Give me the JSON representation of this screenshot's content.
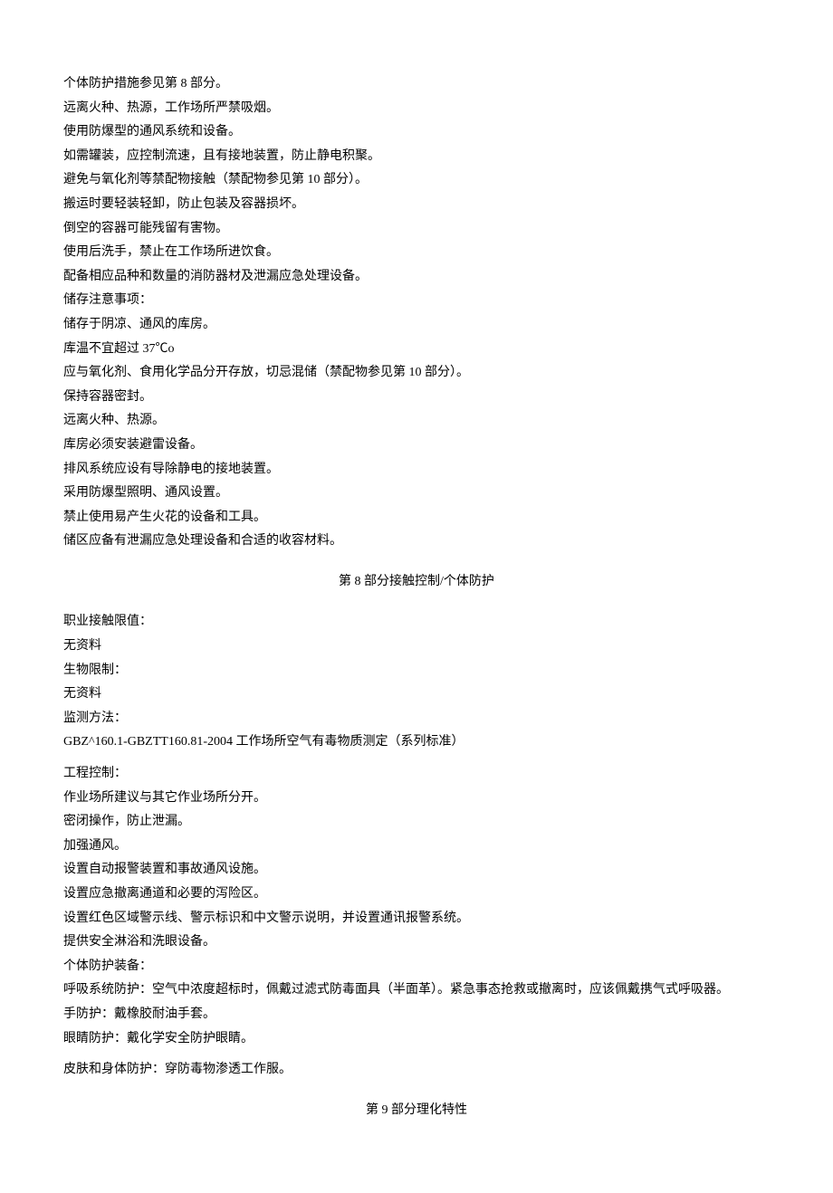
{
  "section7": {
    "lines": [
      "个体防护措施参见第 8 部分。",
      "远离火种、热源，工作场所严禁吸烟。",
      "使用防爆型的通风系统和设备。",
      "如需罐装，应控制流速，且有接地装置，防止静电积聚。",
      "避免与氧化剂等禁配物接触（禁配物参见第 10 部分）。",
      "搬运时要轻装轻卸，防止包装及容器损坏。",
      "倒空的容器可能残留有害物。",
      "使用后洗手，禁止在工作场所进饮食。",
      "配备相应品种和数量的消防器材及泄漏应急处理设备。",
      "储存注意事项：",
      "储存于阴凉、通风的库房。",
      "库温不宜超过 37℃o",
      "应与氧化剂、食用化学品分开存放，切忌混储（禁配物参见第 10 部分）。",
      "保持容器密封。",
      "远离火种、热源。",
      "库房必须安装避雷设备。",
      "排风系统应设有导除静电的接地装置。",
      "采用防爆型照明、通风设置。",
      "禁止使用易产生火花的设备和工具。",
      "储区应备有泄漏应急处理设备和合适的收容材料。"
    ]
  },
  "section8": {
    "title": "第 8 部分接触控制/个体防护",
    "block1": [
      "职业接触限值：",
      "无资料",
      "生物限制：",
      "无资料",
      "监测方法：",
      "GBZ^160.1-GBZTT160.81-2004 工作场所空气有毒物质测定（系列标准）"
    ],
    "block2": [
      "工程控制：",
      "作业场所建议与其它作业场所分开。",
      "密闭操作，防止泄漏。",
      "加强通风。",
      "设置自动报警装置和事故通风设施。",
      "设置应急撤离通道和必要的泻险区。",
      "设置红色区域警示线、警示标识和中文警示说明，并设置通讯报警系统。",
      "提供安全淋浴和洗眼设备。",
      "个体防护装备：",
      "呼吸系统防护：空气中浓度超标时，佩戴过滤式防毒面具（半面革）。紧急事态抢救或撤离时，应该佩戴携气式呼吸器。",
      "手防护：戴橡胶耐油手套。",
      "眼睛防护：戴化学安全防护眼睛。"
    ],
    "block3": [
      "皮肤和身体防护：穿防毒物渗透工作服。"
    ]
  },
  "section9": {
    "title": "第 9 部分理化特性"
  }
}
